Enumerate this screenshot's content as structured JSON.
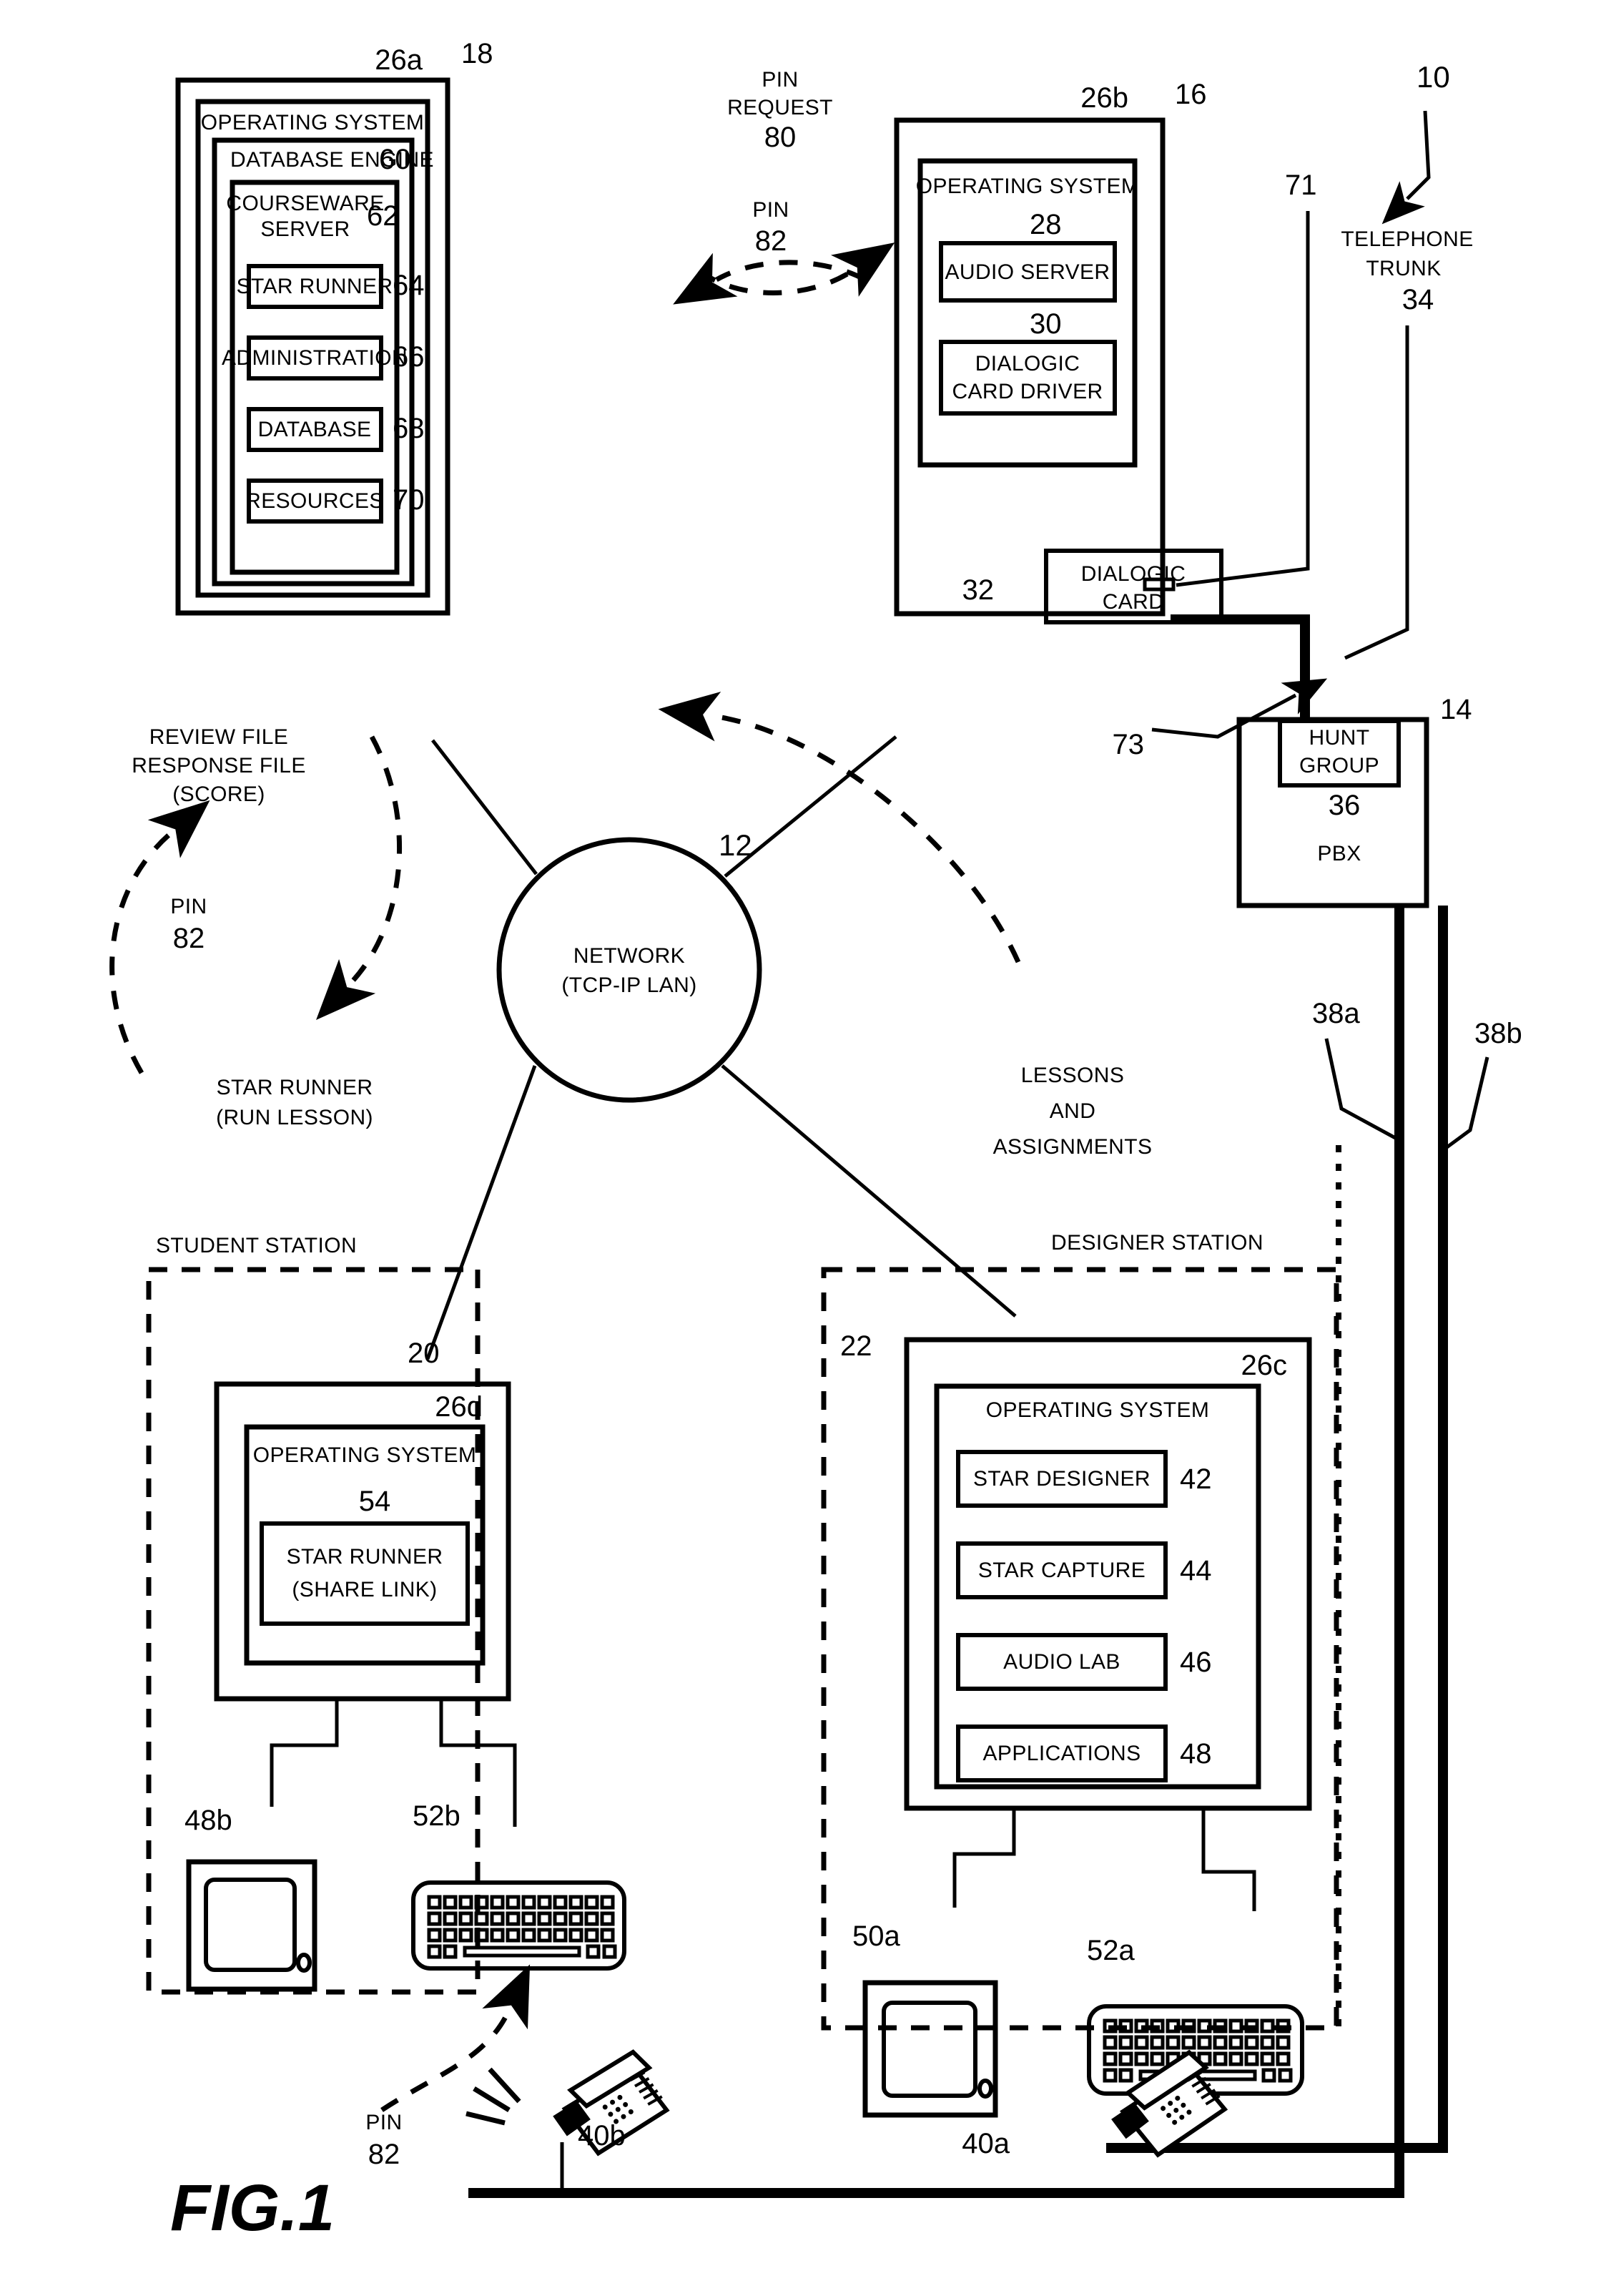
{
  "figure": {
    "label": "FIG.1",
    "system_ref": "10"
  },
  "courseware_server_box": {
    "ref": "18",
    "os_ref": "26a",
    "os_label": "OPERATING SYSTEM",
    "db_engine_label": "DATABASE ENGINE",
    "db_engine_ref": "60",
    "courseware_label_line1": "COURSEWARE",
    "courseware_label_line2": "SERVER",
    "courseware_ref": "62",
    "modules": [
      {
        "label": "STAR RUNNER",
        "ref": "64"
      },
      {
        "label": "ADMINISTRATION",
        "ref": "66"
      },
      {
        "label": "DATABASE",
        "ref": "68"
      },
      {
        "label": "RESOURCES",
        "ref": "70"
      }
    ]
  },
  "audio_server_box": {
    "ref": "16",
    "os_ref": "26b",
    "os_label": "OPERATING SYSTEM",
    "audio_server_label": "AUDIO SERVER",
    "audio_server_ref": "28",
    "driver_label_line1": "DIALOGIC",
    "driver_label_line2": "CARD DRIVER",
    "driver_ref": "30",
    "card_label_line1": "DIALOGIC",
    "card_label_line2": "CARD",
    "card_ref": "32"
  },
  "telephone_trunk": {
    "ref_71": "71",
    "label_line1": "TELEPHONE",
    "label_line2": "TRUNK",
    "ref_34": "34",
    "ref_73": "73"
  },
  "pbx": {
    "ref": "14",
    "hunt_group_line1": "HUNT",
    "hunt_group_line2": "GROUP",
    "hunt_group_ref": "36",
    "label": "PBX",
    "line_38a": "38a",
    "line_38b": "38b"
  },
  "network": {
    "ref": "12",
    "label_line1": "NETWORK",
    "label_line2": "(TCP-IP LAN)"
  },
  "flows": {
    "pin_request_line1": "PIN",
    "pin_request_line2": "REQUEST",
    "pin_request_ref": "80",
    "pin_line1": "PIN",
    "pin_ref": "82",
    "review_line1": "REVIEW FILE",
    "review_line2": "RESPONSE FILE",
    "review_line3": "(SCORE)",
    "pin_left_label": "PIN",
    "pin_left_ref": "82",
    "star_runner_line1": "STAR RUNNER",
    "star_runner_line2": "(RUN LESSON)",
    "lessons_line1": "LESSONS",
    "lessons_line2": "AND",
    "lessons_line3": "ASSIGNMENTS",
    "pin_phone_label": "PIN",
    "pin_phone_ref": "82"
  },
  "student_station": {
    "title": "STUDENT STATION",
    "ref": "20",
    "os_ref": "26d",
    "os_label": "OPERATING SYSTEM",
    "star_runner_ref": "54",
    "star_runner_line1": "STAR RUNNER",
    "star_runner_line2": "(SHARE LINK)",
    "monitor_ref": "48b",
    "keyboard_ref": "52b",
    "phone_ref": "40b"
  },
  "designer_station": {
    "title": "DESIGNER STATION",
    "ref": "22",
    "os_ref": "26c",
    "os_label": "OPERATING SYSTEM",
    "modules": [
      {
        "label": "STAR DESIGNER",
        "ref": "42"
      },
      {
        "label": "STAR CAPTURE",
        "ref": "44"
      },
      {
        "label": "AUDIO LAB",
        "ref": "46"
      },
      {
        "label": "APPLICATIONS",
        "ref": "48"
      }
    ],
    "monitor_ref": "50a",
    "keyboard_ref": "52a",
    "phone_ref": "40a"
  },
  "colors": {
    "ink": "#000000",
    "paper": "#ffffff"
  }
}
